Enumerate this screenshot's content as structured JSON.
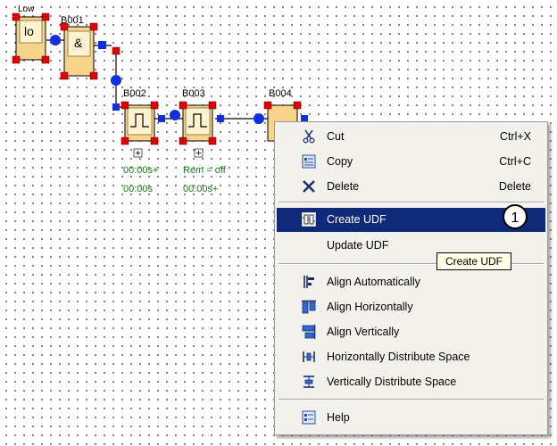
{
  "blocks": {
    "low_label": "Low",
    "lo_text": "lo",
    "b001_label": "B001",
    "and_text": "&",
    "b002_label": "B002",
    "b003_label": "B003",
    "b004_label": "B004"
  },
  "timer_params": {
    "b002_line1": "00:00s+",
    "b002_line2": "00:00s",
    "b003_line1": "Rem = off",
    "b003_line2": "00:00s+"
  },
  "context_menu": {
    "cut": {
      "label": "Cut",
      "shortcut": "Ctrl+X",
      "icon": "scissors-icon"
    },
    "copy": {
      "label": "Copy",
      "shortcut": "Ctrl+C",
      "icon": "copy-icon"
    },
    "delete": {
      "label": "Delete",
      "shortcut": "Delete",
      "icon": "delete-x-icon"
    },
    "create_udf": {
      "label": "Create UDF",
      "icon": "create-udf-icon"
    },
    "update_udf": {
      "label": "Update UDF"
    },
    "align_auto": {
      "label": "Align Automatically",
      "icon": "align-auto-icon"
    },
    "align_h": {
      "label": "Align Horizontally",
      "icon": "align-horizontal-icon"
    },
    "align_v": {
      "label": "Align Vertically",
      "icon": "align-vertical-icon"
    },
    "dist_h": {
      "label": "Horizontally Distribute Space",
      "icon": "distribute-horizontal-icon"
    },
    "dist_v": {
      "label": "Vertically Distribute Space",
      "icon": "distribute-vertical-icon"
    },
    "help": {
      "label": "Help",
      "icon": "help-icon"
    }
  },
  "tooltip": "Create UDF",
  "callout_number": "1",
  "colors": {
    "menu_highlight": "#0e2a79",
    "block_fill": "#f6d58a",
    "handle": "#e00000",
    "connector": "#1030e0",
    "timer_text": "#1b7d1b"
  }
}
